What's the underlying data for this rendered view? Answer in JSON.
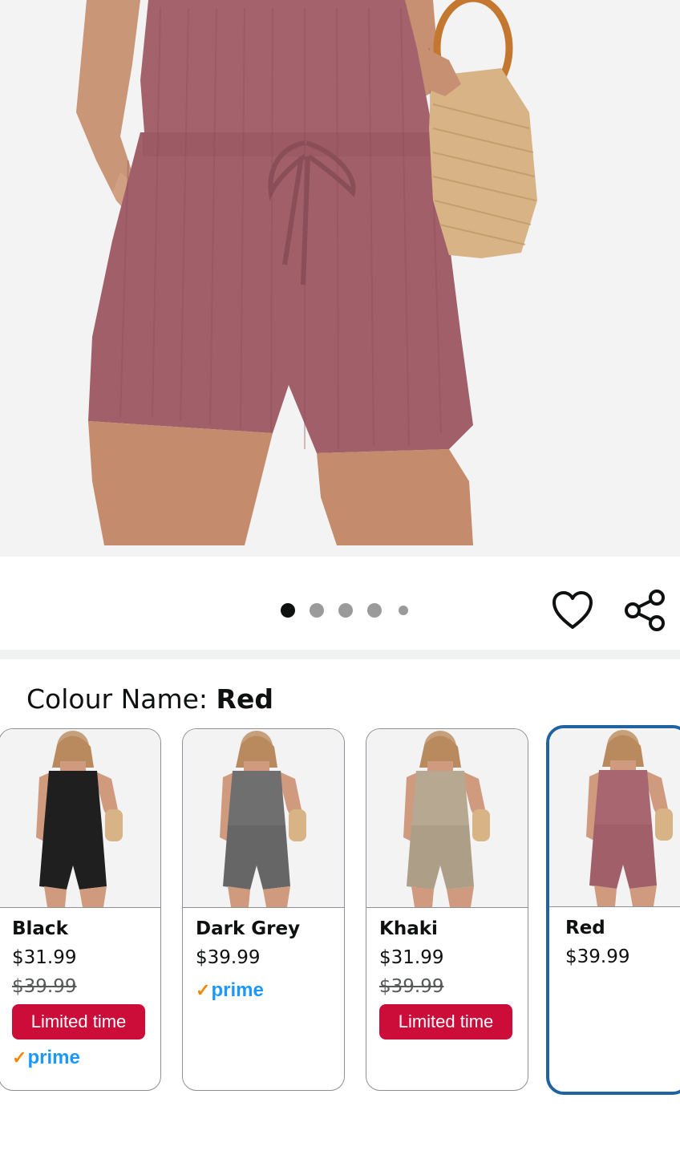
{
  "gallery": {
    "image_alt": "Red ribbed knit romper shorts with drawstring, model holding woven straw bag",
    "dots_count": 5,
    "active_dot": 0
  },
  "actions": {
    "wishlist_icon": "heart-icon",
    "share_icon": "share-icon"
  },
  "colour": {
    "label": "Colour Name: ",
    "selected": "Red"
  },
  "swatches": [
    {
      "name": "Black",
      "price": "$31.99",
      "was_price": "$39.99",
      "badge": "Limited time",
      "prime": "prime",
      "color": "#1f1f1f"
    },
    {
      "name": "Dark Grey",
      "price": "$39.99",
      "was_price": "",
      "badge": "",
      "prime": "prime",
      "color": "#6f6f6f"
    },
    {
      "name": "Khaki",
      "price": "$31.99",
      "was_price": "$39.99",
      "badge": "Limited time",
      "prime": "",
      "color": "#b7a892"
    },
    {
      "name": "Red",
      "price": "$39.99",
      "was_price": "",
      "badge": "",
      "prime": "",
      "color": "#a86670"
    }
  ],
  "colors": {
    "badge_red": "#cc0c39",
    "selected_border": "#2162a1",
    "prime_blue": "#1a98ff",
    "product_color": "#a4636c"
  }
}
